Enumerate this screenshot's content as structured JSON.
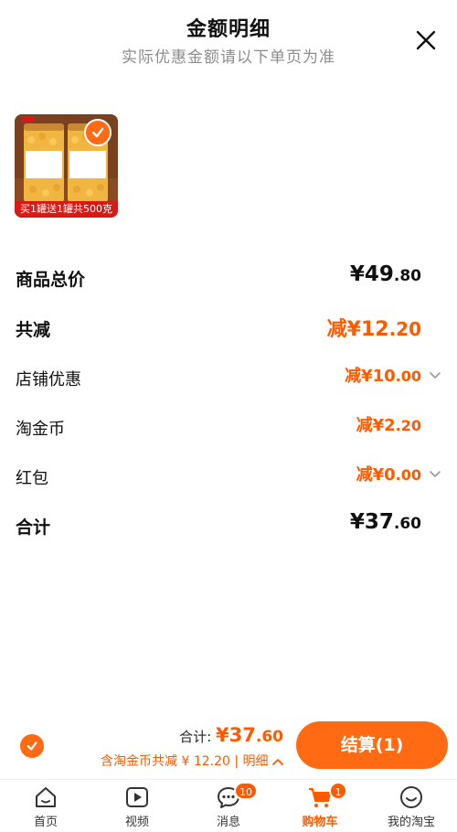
{
  "header": {
    "title": "金额明细",
    "subtitle": "实际优惠金额请以下单页为准",
    "close_icon": "close-icon"
  },
  "product": {
    "promo_text": "买1罐送1罐共500克",
    "selected": true
  },
  "rows": {
    "total_price": {
      "label": "商品总价",
      "symbol": "¥",
      "int": "49",
      "cents": ".80"
    },
    "total_discount": {
      "label": "共减",
      "prefix": "减¥",
      "int": "12",
      "cents": ".20"
    },
    "shop_discount": {
      "label": "店铺优惠",
      "prefix": "减¥",
      "int": "10",
      "cents": ".00"
    },
    "taojinbi": {
      "label": "淘金币",
      "prefix": "减¥",
      "int": "2",
      "cents": ".20"
    },
    "red_packet": {
      "label": "红包",
      "prefix": "减¥",
      "int": "0",
      "cents": ".00"
    },
    "grand_total": {
      "label": "合计",
      "symbol": "¥",
      "int": "37",
      "cents": ".60"
    }
  },
  "checkout": {
    "total_label": "合计: ",
    "total_prefix": "¥",
    "total_int": "37",
    "total_cents": ".60",
    "discount_text": "含淘金币共减 ¥ 12.20 | 明细",
    "pay_button": "结算(1)"
  },
  "tabbar": {
    "items": [
      {
        "label": "首页",
        "icon": "home-icon"
      },
      {
        "label": "视频",
        "icon": "video-icon"
      },
      {
        "label": "消息",
        "icon": "message-icon",
        "badge": "10"
      },
      {
        "label": "购物车",
        "icon": "cart-icon",
        "badge": "1",
        "active": true
      },
      {
        "label": "我的淘宝",
        "icon": "profile-icon"
      }
    ]
  },
  "colors": {
    "accent": "#ff6a13",
    "price_orange": "#ff5a00",
    "promo_red": "#d61a16"
  }
}
